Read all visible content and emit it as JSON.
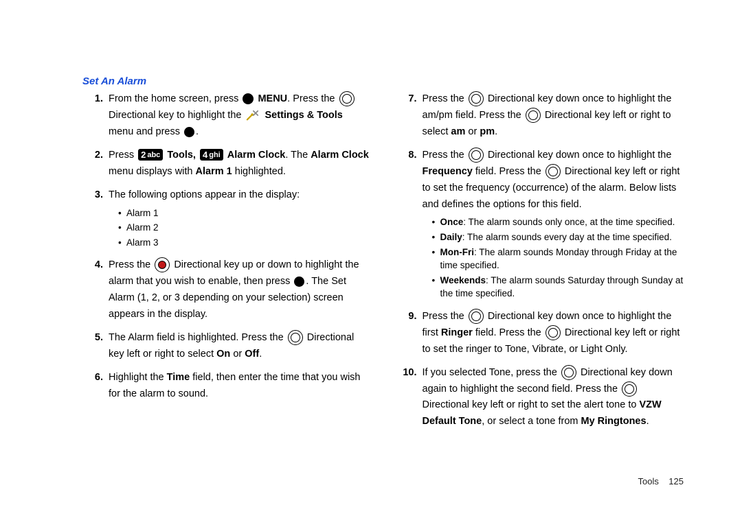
{
  "section_title": "Set An Alarm",
  "footer": {
    "label": "Tools",
    "page": "125"
  },
  "keys": {
    "two_abc_num": "2",
    "two_abc_txt": "abc",
    "four_ghi_num": "4",
    "four_ghi_txt": "ghi"
  },
  "steps": {
    "s1": {
      "num": "1.",
      "a": "From the home screen, press ",
      "menu": "MENU",
      "b": ". Press the ",
      "c": "Directional key to highlight the ",
      "st": "Settings & Tools",
      "d": " menu and press ",
      "e": "."
    },
    "s2": {
      "num": "2.",
      "a": "Press ",
      "tools": " Tools, ",
      "ac": " Alarm Clock",
      "b": ". The ",
      "alarm": "Alarm Clock",
      "c": " menu displays with ",
      "a1": "Alarm 1",
      "d": " highlighted."
    },
    "s3": {
      "num": "3.",
      "a": "The following options appear in the display:",
      "bullets": {
        "b1": "Alarm 1",
        "b2": "Alarm 2",
        "b3": "Alarm 3"
      }
    },
    "s4": {
      "num": "4.",
      "a": "Press the ",
      "b": " Directional key up or down to highlight the alarm that you wish to enable, then press ",
      "c": ". The Set Alarm (1, 2, or 3 depending on your selection) screen appears in the display."
    },
    "s5": {
      "num": "5.",
      "a": "The Alarm field is highlighted. Press the ",
      "b": " Directional key left or right to select ",
      "on": "On",
      "or": " or ",
      "off": "Off",
      "c": "."
    },
    "s6": {
      "num": "6.",
      "a": "Highlight the ",
      "time": "Time",
      "b": " field, then enter the time that you wish for the alarm to sound."
    },
    "s7": {
      "num": "7.",
      "a": "Press the ",
      "b": " Directional key down once to highlight the am/pm field. Press the ",
      "c": " Directional key left or right to select ",
      "am": "am",
      "or": " or ",
      "pm": "pm",
      "d": "."
    },
    "s8": {
      "num": "8.",
      "a": "Press the ",
      "b": " Directional key down once to highlight the ",
      "freq": "Frequency",
      "c": " field. Press the ",
      "d": " Directional key left or right to set the frequency (occurrence) of the alarm. Below lists and defines the options for this field.",
      "bullets": {
        "once_l": "Once",
        "once_t": ": The alarm sounds only once, at the time specified.",
        "daily_l": "Daily",
        "daily_t": ": The alarm sounds every day at the time specified.",
        "mf_l": "Mon-Fri",
        "mf_t": ": The alarm sounds Monday through Friday at the time specified.",
        "wk_l": "Weekends",
        "wk_t": ": The alarm sounds Saturday through Sunday at the time specified."
      }
    },
    "s9": {
      "num": "9.",
      "a": "Press the ",
      "b": " Directional key down once to highlight the first ",
      "ringer": "Ringer",
      "c": " field. Press the ",
      "d": " Directional key left or right to set the ringer to Tone, Vibrate, or Light Only."
    },
    "s10": {
      "num": "10.",
      "a": "If you selected Tone, press the ",
      "b": " Directional key down again to highlight the second field. Press the ",
      "c": " Directional key left or right to set the alert tone to ",
      "vzw": "VZW Default Tone",
      "d": ", or select a tone from ",
      "myr": "My Ringtones",
      "e": "."
    }
  }
}
